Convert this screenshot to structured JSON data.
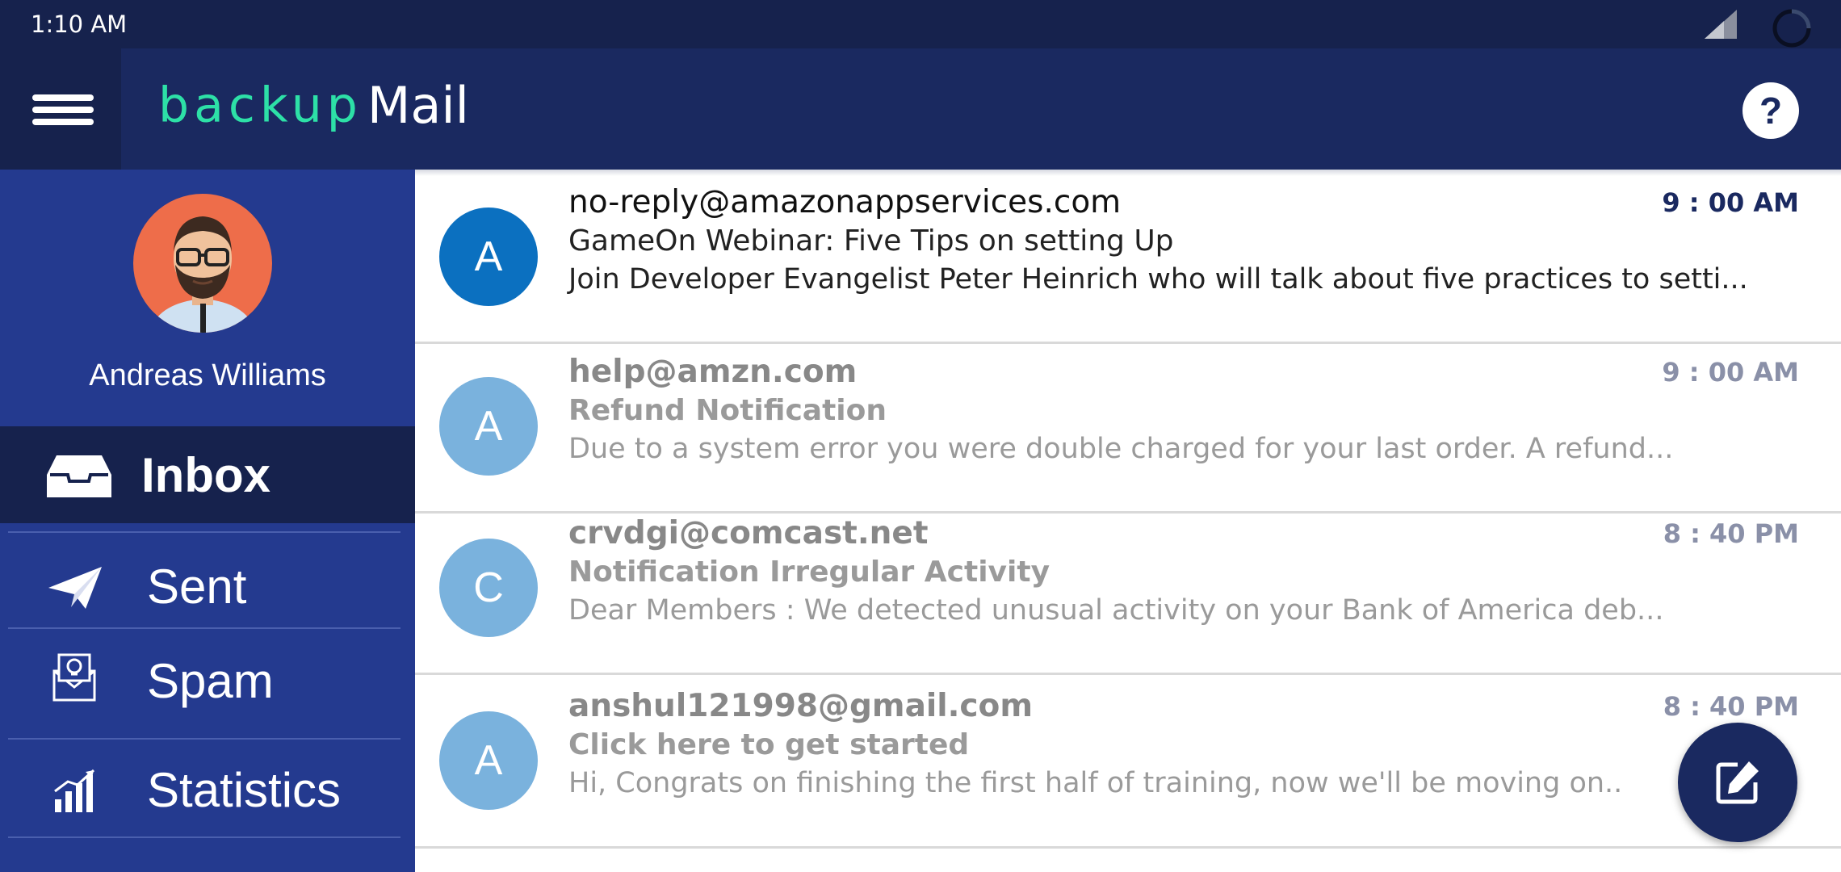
{
  "status_bar": {
    "time": "1:10 AM",
    "icons": [
      "signal-icon",
      "loading-icon"
    ]
  },
  "app_bar": {
    "logo_part1": "backup",
    "logo_part2": "Mail",
    "menu_icon": "hamburger-menu-icon",
    "help_label": "?"
  },
  "sidebar": {
    "user_name": "Andreas Williams",
    "items": [
      {
        "label": "Inbox",
        "icon": "inbox-tray-icon",
        "active": true
      },
      {
        "label": "Sent",
        "icon": "paper-plane-icon",
        "active": false
      },
      {
        "label": "Spam",
        "icon": "spam-envelope-icon",
        "active": false
      },
      {
        "label": "Statistics",
        "icon": "bar-chart-icon",
        "active": false
      }
    ]
  },
  "emails": [
    {
      "initial": "A",
      "from": "no-reply@amazonappservices.com",
      "subject": "GameOn Webinar: Five Tips on setting Up",
      "preview": "Join Developer Evangelist Peter Heinrich who will talk about five practices to setti...",
      "time": "9 : 00 AM",
      "unread": true
    },
    {
      "initial": "A",
      "from": "help@amzn.com",
      "subject": "Refund Notification",
      "preview": "Due to a system error you were double charged for your last order. A refund...",
      "time": "9 : 00 AM",
      "unread": false
    },
    {
      "initial": "C",
      "from": "crvdgi@comcast.net",
      "subject": "Notification Irregular Activity",
      "preview": "Dear Members : We detected unusual activity on your Bank of America deb...",
      "time": "8 : 40 PM",
      "unread": false
    },
    {
      "initial": "A",
      "from": "anshul121998@gmail.com",
      "subject": "Click here to get started",
      "preview": "Hi, Congrats on finishing the first half of training, now we'll be moving on..",
      "time": "8 : 40 PM",
      "unread": false
    }
  ],
  "fab": {
    "icon": "compose-edit-icon"
  },
  "colors": {
    "status_bar": "#16224d",
    "app_bar": "#1a2960",
    "sidebar": "#243a8f",
    "logo_accent": "#2de0a7",
    "unread_avatar": "#0b70c0",
    "read_avatar": "#7ab2dd"
  }
}
